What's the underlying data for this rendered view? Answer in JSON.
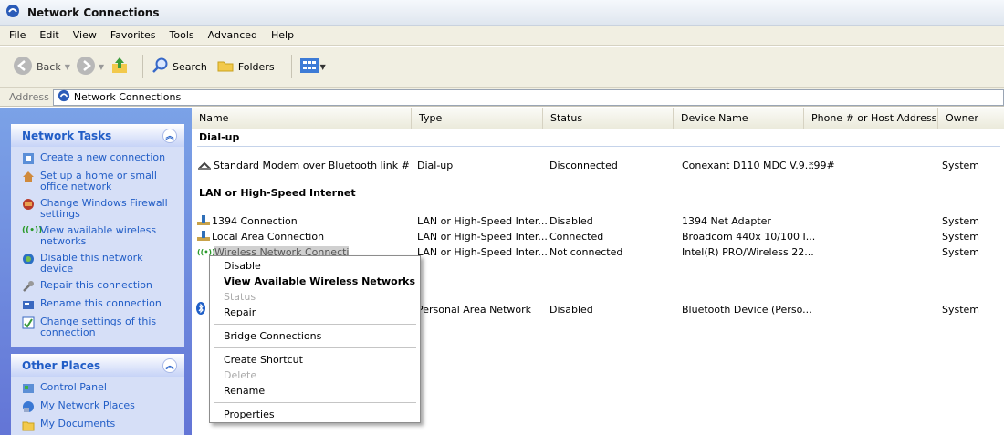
{
  "window": {
    "title": "Network Connections"
  },
  "menu": [
    "File",
    "Edit",
    "View",
    "Favorites",
    "Tools",
    "Advanced",
    "Help"
  ],
  "toolbar": {
    "back": "Back",
    "search": "Search",
    "folders": "Folders"
  },
  "address": {
    "label": "Address",
    "value": "Network Connections"
  },
  "network_tasks": {
    "title": "Network Tasks",
    "items": [
      "Create a new connection",
      "Set up a home or small office network",
      "Change Windows Firewall settings",
      "View available wireless networks",
      "Disable this network device",
      "Repair this connection",
      "Rename this connection",
      "Change settings of this connection"
    ]
  },
  "other_places": {
    "title": "Other Places",
    "items": [
      "Control Panel",
      "My Network Places",
      "My Documents"
    ]
  },
  "columns": [
    "Name",
    "Type",
    "Status",
    "Device Name",
    "Phone # or Host Address",
    "Owner"
  ],
  "groups": {
    "dialup": "Dial-up",
    "lan": "LAN or High-Speed Internet"
  },
  "rows": {
    "modem": {
      "name": "Standard Modem over Bluetooth link #2 (...",
      "type": "Dial-up",
      "status": "Disconnected",
      "device": "Conexant D110 MDC V.9...",
      "phone": "*99#",
      "owner": "System"
    },
    "r1394": {
      "name": "1394 Connection",
      "type": "LAN or High-Speed Inter...",
      "status": "Disabled",
      "device": "1394 Net Adapter",
      "phone": "",
      "owner": "System"
    },
    "local": {
      "name": "Local Area Connection",
      "type": "LAN or High-Speed Inter...",
      "status": "Connected",
      "device": "Broadcom 440x 10/100 I...",
      "phone": "",
      "owner": "System"
    },
    "wireless": {
      "name": "Wireless Network Connection",
      "type": "LAN or High-Speed Inter...",
      "status": "Not connected",
      "device": "Intel(R) PRO/Wireless 22...",
      "phone": "",
      "owner": "System"
    },
    "bt": {
      "name": "",
      "type": "Personal Area Network",
      "status": "Disabled",
      "device": "Bluetooth Device (Perso...",
      "phone": "",
      "owner": "System"
    }
  },
  "context_menu": {
    "disable": "Disable",
    "view_wireless": "View Available Wireless Networks",
    "status": "Status",
    "repair": "Repair",
    "bridge": "Bridge Connections",
    "shortcut": "Create Shortcut",
    "delete": "Delete",
    "rename": "Rename",
    "properties": "Properties"
  },
  "colors": {
    "task_link": "#215dc6",
    "pane_bg": "#7ba2e7",
    "panel_bg": "#d6dff7"
  }
}
